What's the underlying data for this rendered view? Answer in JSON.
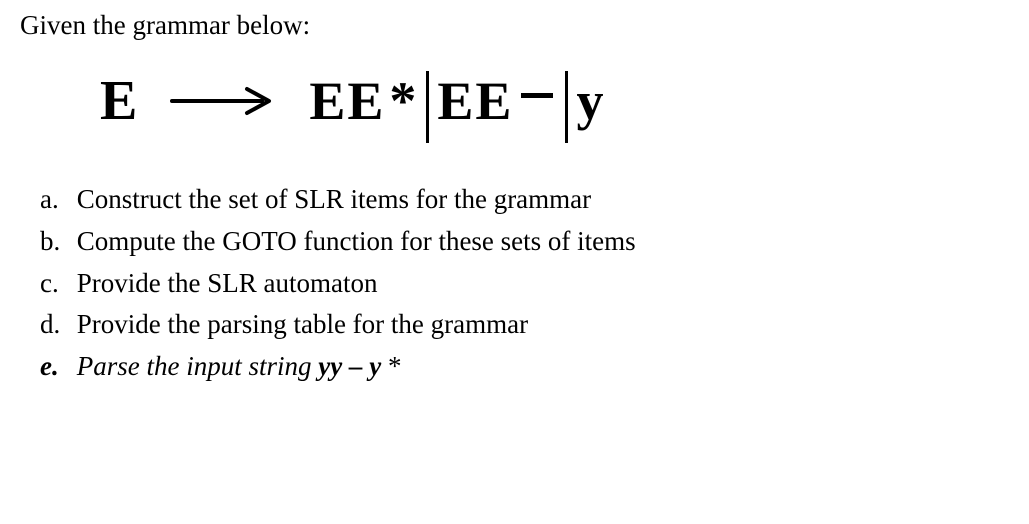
{
  "intro": "Given the grammar below:",
  "grammar": {
    "lhs": "E",
    "rhs_parts": {
      "p1a": "EE",
      "p1b": "*",
      "p2a": "EE",
      "p3": "y"
    }
  },
  "parts": {
    "a": {
      "label": "a.",
      "text": "Construct the set of SLR items for the grammar"
    },
    "b": {
      "label": "b.",
      "text": "Compute the GOTO function for these sets of items"
    },
    "c": {
      "label": "c.",
      "text": "Provide the SLR automaton"
    },
    "d": {
      "label": "d.",
      "text": "Provide the parsing table for the grammar"
    },
    "e": {
      "label": "e.",
      "text_prefix": "Parse the input string ",
      "expr_y1": "yy",
      "expr_dash": " – ",
      "expr_y2": "y",
      "expr_star": " *"
    }
  }
}
